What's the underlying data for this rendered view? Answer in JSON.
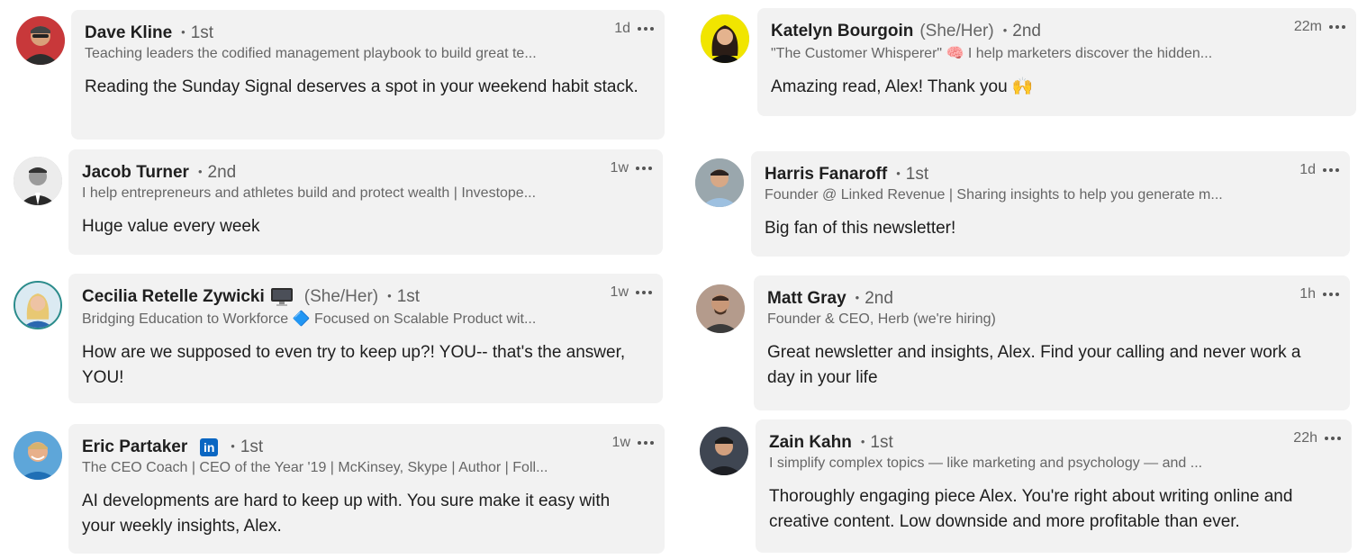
{
  "accent": "#0a66c2",
  "comments": [
    {
      "name": "Dave Kline",
      "degree": "1st",
      "time": "1d",
      "headline": "Teaching leaders the codified management playbook to build great te...",
      "body": "Reading the Sunday Signal deserves a spot in your weekend habit stack.",
      "avatar_bg": "#c8383a"
    },
    {
      "name": "Katelyn Bourgoin",
      "pronoun": "(She/Her)",
      "degree": "2nd",
      "time": "22m",
      "headline": "\"The Customer Whisperer\" 🧠 I help marketers discover the hidden...",
      "body": "Amazing read, Alex! Thank you 🙌",
      "avatar_bg": "#f1e500"
    },
    {
      "name": "Jacob Turner",
      "degree": "2nd",
      "time": "1w",
      "headline": "I help entrepreneurs and athletes build and protect wealth | Investope...",
      "body": "Huge value every week",
      "avatar_bg": "#e8e8e8"
    },
    {
      "name": "Harris Fanaroff",
      "degree": "1st",
      "time": "1d",
      "headline": "Founder @ Linked Revenue | Sharing insights to help you generate m...",
      "body": "Big fan of this newsletter!",
      "avatar_bg": "#9aa7ad"
    },
    {
      "name": "Cecilia Retelle Zywicki",
      "emoji": "monitor-icon",
      "pronoun": "(She/Her)",
      "degree": "1st",
      "time": "1w",
      "headline": "Bridging Education to Workforce 🔷 Focused on Scalable Product wit...",
      "body": "How are we supposed to even try to keep up?! YOU-- that's the answer, YOU!",
      "avatar_bg": "#cfe4ef"
    },
    {
      "name": "Matt Gray",
      "degree": "2nd",
      "time": "1h",
      "headline": "Founder & CEO, Herb (we're hiring)",
      "body": "Great newsletter and insights, Alex. Find your calling and never work a day in your life",
      "avatar_bg": "#8a7265"
    },
    {
      "name": "Eric Partaker",
      "badge": "in",
      "degree": "1st",
      "time": "1w",
      "headline": "The CEO Coach | CEO of the Year '19 | McKinsey, Skype | Author | Foll...",
      "body": "AI developments are hard to keep up with. You sure make it easy with your weekly insights, Alex.",
      "avatar_bg": "#5ea6d9"
    },
    {
      "name": "Zain Kahn",
      "degree": "1st",
      "time": "22h",
      "headline": "I simplify complex topics — like marketing and psychology — and ...",
      "body": "Thoroughly engaging piece Alex. You're right about writing online and creative content. Low downside and more profitable than ever.",
      "avatar_bg": "#3f4652"
    }
  ]
}
